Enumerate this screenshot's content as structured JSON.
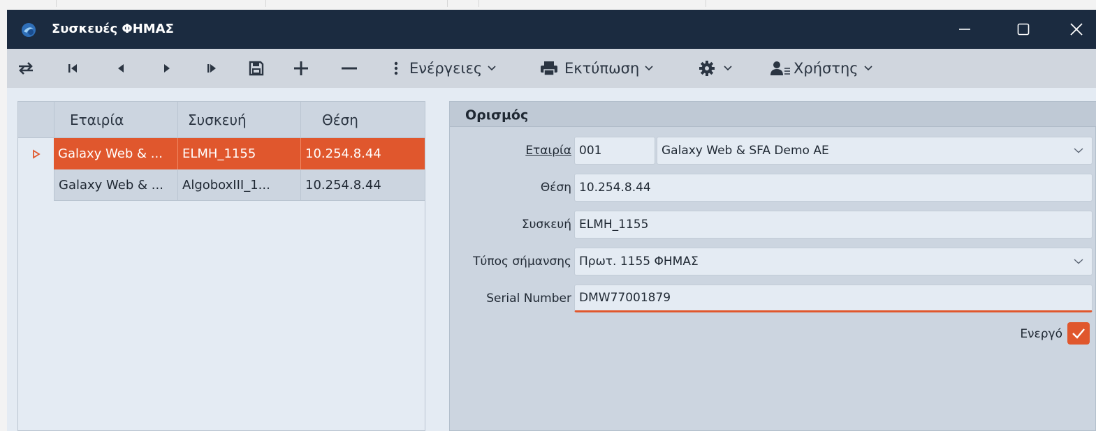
{
  "window": {
    "title": "Συσκευές ΦΗΜΑΣ"
  },
  "toolbar": {
    "actions_label": "Ενέργειες",
    "print_label": "Εκτύπωση",
    "user_label": "Χρήστης"
  },
  "grid": {
    "columns": [
      "Εταιρία",
      "Συσκευή",
      "Θέση"
    ],
    "rows": [
      {
        "company": "Galaxy Web & ...",
        "device": "ELMH_1155",
        "position": "10.254.8.44",
        "selected": true
      },
      {
        "company": "Galaxy Web & ...",
        "device": "AlgoboxIII_1...",
        "position": "10.254.8.44",
        "selected": false
      }
    ]
  },
  "form": {
    "section_title": "Ορισμός",
    "company_label": "Εταιρία",
    "company_code": "001",
    "company_name": "Galaxy Web & SFA Demo AE",
    "position_label": "Θέση",
    "position_value": "10.254.8.44",
    "device_label": "Συσκευή",
    "device_value": "ELMH_1155",
    "marking_type_label": "Τύπος σήμανσης",
    "marking_type_value": "Πρωτ. 1155 ΦΗΜΑΣ",
    "serial_label": "Serial Number",
    "serial_value": "DMW77001879",
    "active_label": "Ενεργό",
    "active_checked": true
  },
  "colors": {
    "accent": "#e0572d",
    "titlebar": "#1b2b40",
    "toolbar": "#d0d6de",
    "panel": "#ccd5e0",
    "field": "#e4ebf3"
  }
}
